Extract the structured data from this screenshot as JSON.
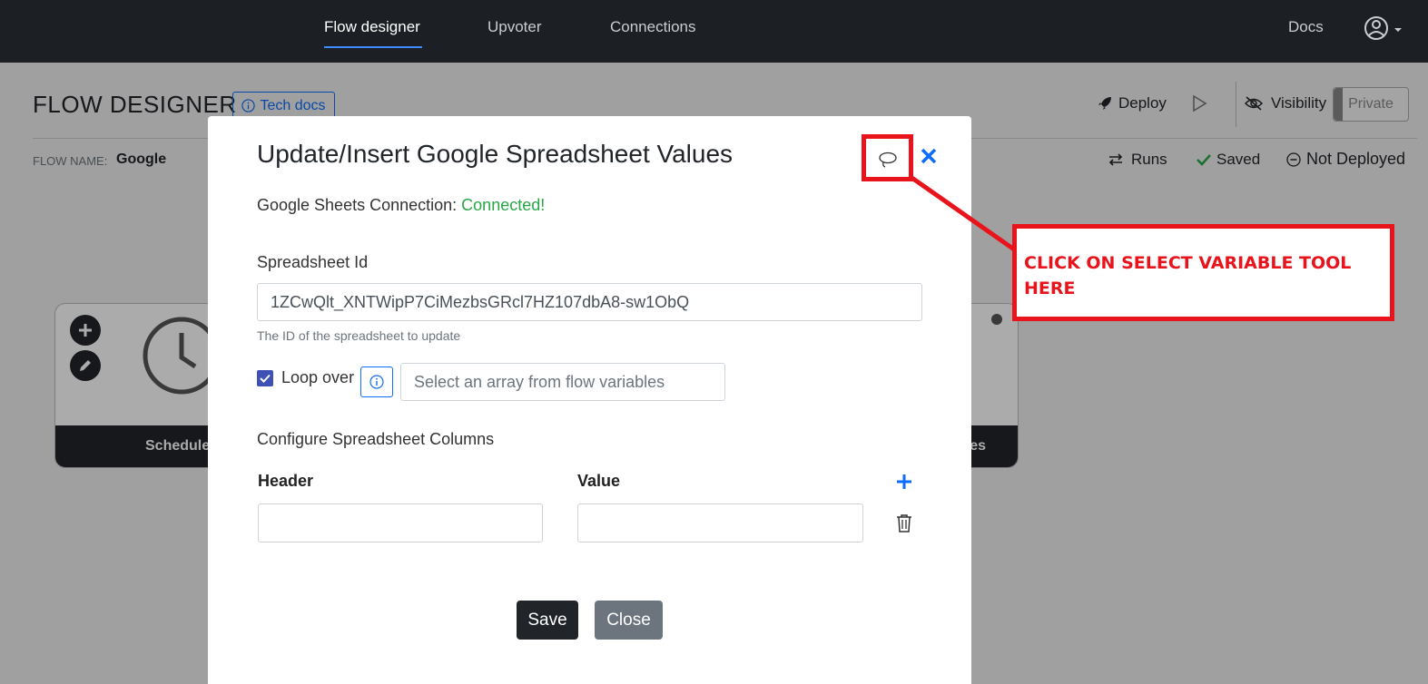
{
  "nav": {
    "items": [
      "Flow designer",
      "Upvoter",
      "Connections"
    ],
    "docs": "Docs"
  },
  "page": {
    "title": "FLOW DESIGNER",
    "tech_docs": "Tech docs",
    "deploy": "Deploy",
    "visibility": "Visibility",
    "private": "Private",
    "flow_name_label": "FLOW NAME:",
    "flow_name": "Google",
    "runs": "Runs",
    "saved": "Saved",
    "not_deployed": "Not Deployed",
    "card_label_left": "Schedule",
    "card_label_right": "lues"
  },
  "modal": {
    "title": "Update/Insert Google Spreadsheet Values",
    "connection_label": "Google Sheets Connection:",
    "connection_status": "Connected!",
    "spreadsheet_label": "Spreadsheet Id",
    "spreadsheet_value": "1ZCwQlt_XNTWipP7CiMezbsGRcl7HZ107dbA8-sw1ObQ",
    "spreadsheet_help": "The ID of the spreadsheet to update",
    "loop_label": "Loop over",
    "loop_checked": true,
    "loop_placeholder": "Select an array from flow variables",
    "columns_label": "Configure Spreadsheet Columns",
    "header_col": "Header",
    "value_col": "Value",
    "header_value": "",
    "value_value": "",
    "save": "Save",
    "close": "Close"
  },
  "annotation": {
    "text": "CLICK ON SELECT VARIABLE TOOL HERE",
    "color": "#e8131b"
  }
}
